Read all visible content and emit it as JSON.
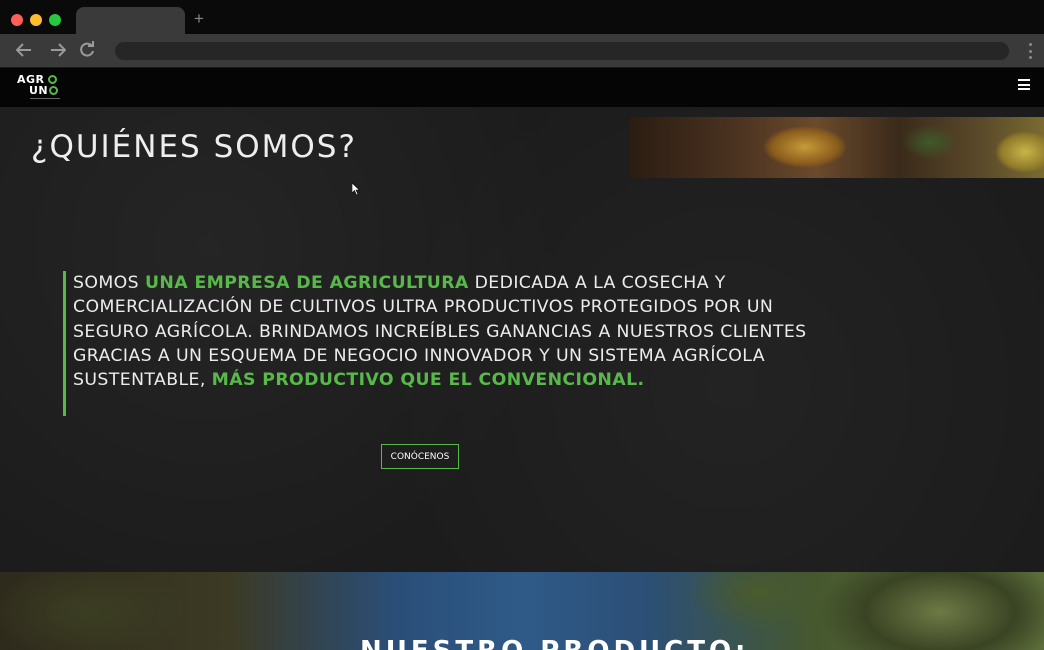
{
  "site": {
    "logo_line1": "AGR",
    "logo_line2": "UN",
    "brand_color": "#58b94a"
  },
  "hero": {
    "title": "¿QUIÉNES SOMOS?",
    "text_1": "SOMOS ",
    "highlight_1": "UNA EMPRESA DE AGRICULTURA",
    "text_2": " DEDICADA A LA COSECHA Y COMERCIALIZACIÓN DE CULTIVOS ULTRA PRODUCTIVOS PROTEGIDOS POR UN SEGURO AGRÍCOLA. BRINDAMOS INCREÍBLES GANANCIAS A NUESTROS CLIENTES GRACIAS A UN ESQUEMA DE NEGOCIO INNOVADOR Y UN SISTEMA AGRÍCOLA SUSTENTABLE, ",
    "highlight_2": "MÁS PRODUCTIVO QUE EL CONVENCIONAL.",
    "cta_label": "CONÓCENOS"
  },
  "product": {
    "title": "NUESTRO PRODUCTO:"
  },
  "icons": {
    "back": "arrow-left-icon",
    "forward": "arrow-right-icon",
    "reload": "reload-icon",
    "menu": "hamburger-menu-icon",
    "new_tab": "plus-icon",
    "browser_menu": "kebab-menu-icon"
  }
}
